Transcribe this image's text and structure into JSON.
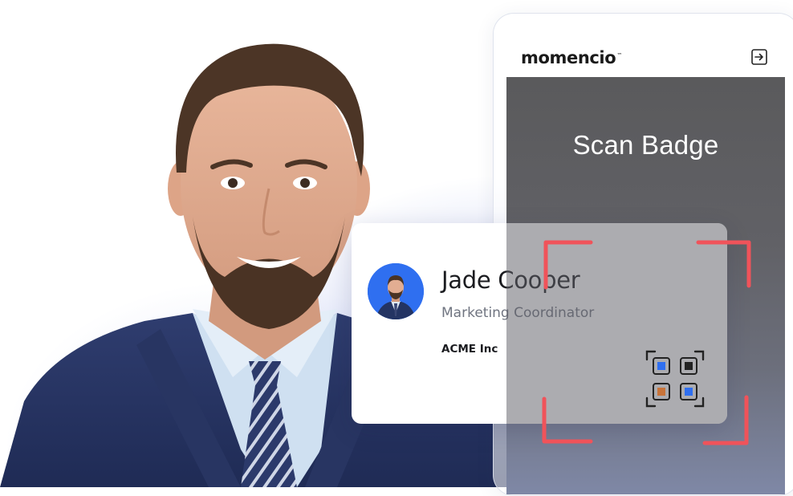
{
  "brand": {
    "name": "momencio",
    "trademark": "™"
  },
  "scanner": {
    "title": "Scan Badge"
  },
  "badge": {
    "name": "Jade Cooper",
    "title": "Marketing Coordinator",
    "company": "ACME Inc"
  },
  "icons": {
    "exit": "exit-icon",
    "qr": "qr-code-icon",
    "scan_frame": "scan-frame-corners"
  },
  "colors": {
    "scan_frame": "#f0535a",
    "avatar_bg": "#2f6ff0",
    "screen_dark": "#5a5a5c",
    "glow": "#6078dc"
  }
}
